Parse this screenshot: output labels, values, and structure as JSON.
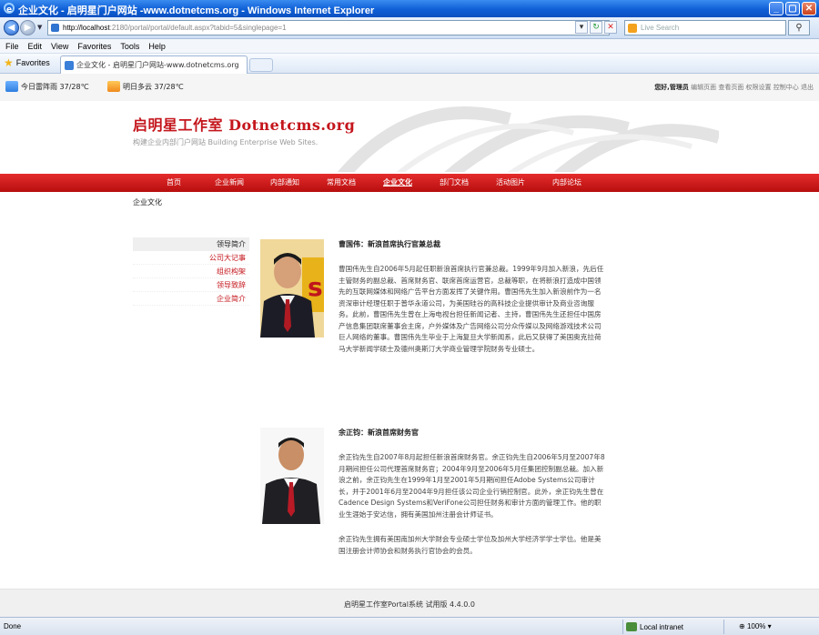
{
  "browser": {
    "window_title": "企业文化 - 启明星门户网站 -www.dotnetcms.org - Windows Internet Explorer",
    "url_host": "http://localhost",
    "url_rest": ":2180/portal/portal/default.aspx?tabid=5&singlepage=1",
    "search_placeholder": "Live Search",
    "menu": [
      "File",
      "Edit",
      "View",
      "Favorites",
      "Tools",
      "Help"
    ],
    "favorites_label": "Favorites",
    "tab_title": "企业文化 - 启明星门户网站-www.dotnetcms.org",
    "status_text": "Done",
    "zone_label": "Local intranet",
    "zoom_label": "100%"
  },
  "weather": {
    "today": "今日雷阵雨 37/28℃",
    "tomorrow": "明日多云 37/28℃"
  },
  "userbar": {
    "greeting": "您好,管理员",
    "links": "编辑页面 查看页面 权限设置 控制中心 退出"
  },
  "site": {
    "title": "启明星工作室 Dotnetcms.org",
    "subtitle": "构建企业内部门户网站 Building Enterprise Web Sites."
  },
  "nav": [
    {
      "label": "首页",
      "w": 0
    },
    {
      "label": "企业新闻"
    },
    {
      "label": "内部通知"
    },
    {
      "label": "常用文档"
    },
    {
      "label": "企业文化",
      "active": true
    },
    {
      "label": "部门文档"
    },
    {
      "label": "活动图片"
    },
    {
      "label": "内部论坛"
    }
  ],
  "breadcrumb": "企业文化",
  "left_menu": [
    {
      "label": "领导简介",
      "current": true
    },
    {
      "label": "公司大记事"
    },
    {
      "label": "组织构架"
    },
    {
      "label": "领导致辞"
    },
    {
      "label": "企业简介"
    }
  ],
  "leaders": [
    {
      "name": "曹国伟：新浪首席执行官兼总裁",
      "bio": "曹国伟先生自2006年5月起任职新浪首席执行官兼总裁。1999年9月加入新浪，先后任主管财务的副总裁、首席财务官、联席首席运营官，总裁等职，在将新浪打造成中国领先的互联网媒体和网络广告平台方面发挥了关键作用。曹国伟先生加入新浪前作为一名资深审计经理任职于普华永道公司，为美国硅谷的高科技企业提供审计及商业咨询服务。此前，曹国伟先生曾在上海电视台担任新闻记者、主持，曹国伟先生还担任中国房产信息集团联席董事会主席，户外媒体及广告网络公司分众传媒以及网络游戏技术公司巨人网络的董事。曹国伟先生毕业于上海复旦大学新闻系，此后又获得了美国奥克拉荷马大学新闻学硕士及德州奥斯汀大学商业管理学院财务专业硕士。"
    },
    {
      "name": "余正钧：新浪首席财务官",
      "bio": "余正钧先生自2007年8月起担任新浪首席财务官。余正钧先生自2006年5月至2007年8月期间担任公司代理首席财务官；2004年9月至2006年5月任集团控制副总裁。加入新浪之前，余正钧先生在1999年1月至2001年5月期间担任Adobe Systems公司审计长，并于2001年6月至2004年9月担任该公司企业行销控制官。此外，余正钧先生曾在Cadence Design Systems和VeriFone公司担任财务和审计方面的管理工作。他的职业生涯始于安达信，拥有美国加州注册会计师证书。",
      "bio2": "余正钧先生拥有美国南加州大学财会专业硕士学位及加州大学经济学学士学位。他是美国注册会计师协会和财务执行官协会的会员。"
    }
  ],
  "footer": "启明星工作室Portal系统 试用版 4.4.0.0",
  "colors": {
    "brand_red": "#c4161c",
    "nav_red": "#d21d1d",
    "ie_blue": "#0f5fd6"
  }
}
